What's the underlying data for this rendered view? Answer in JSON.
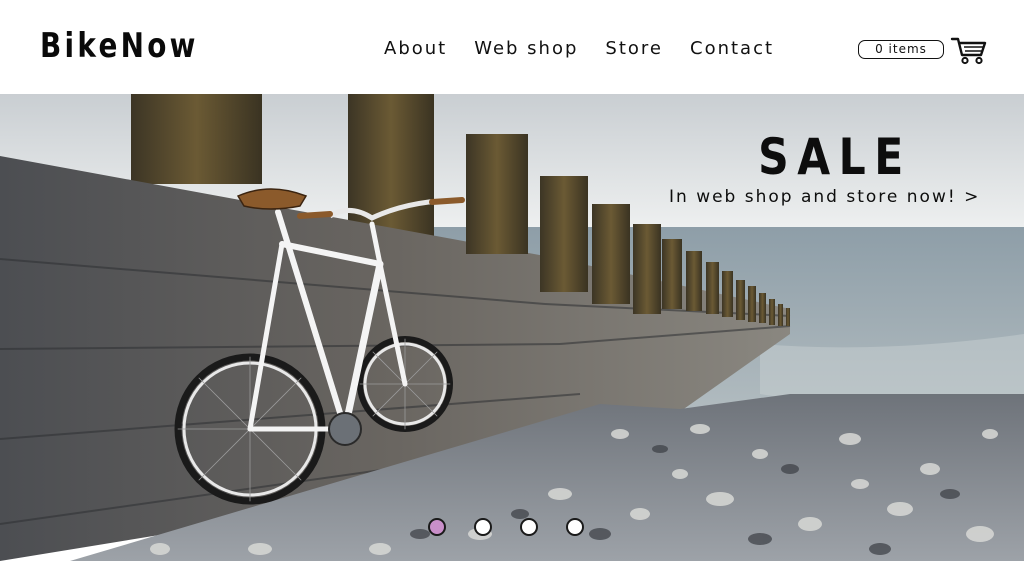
{
  "brand": {
    "logo": "BikeNow"
  },
  "nav": {
    "items": [
      {
        "label": "About"
      },
      {
        "label": "Web shop"
      },
      {
        "label": "Store"
      },
      {
        "label": "Contact"
      }
    ]
  },
  "cart": {
    "count_label": "0 items",
    "icon": "shopping-cart-icon"
  },
  "hero": {
    "title": "SALE",
    "subtitle": "In web shop and store now! >",
    "image": "white-fixed-gear-bicycle-leaning-on-wooden-groyne-pebble-beach",
    "carousel": {
      "slide_count": 4,
      "active_index": 0,
      "active_color": "#c98fc9"
    }
  }
}
